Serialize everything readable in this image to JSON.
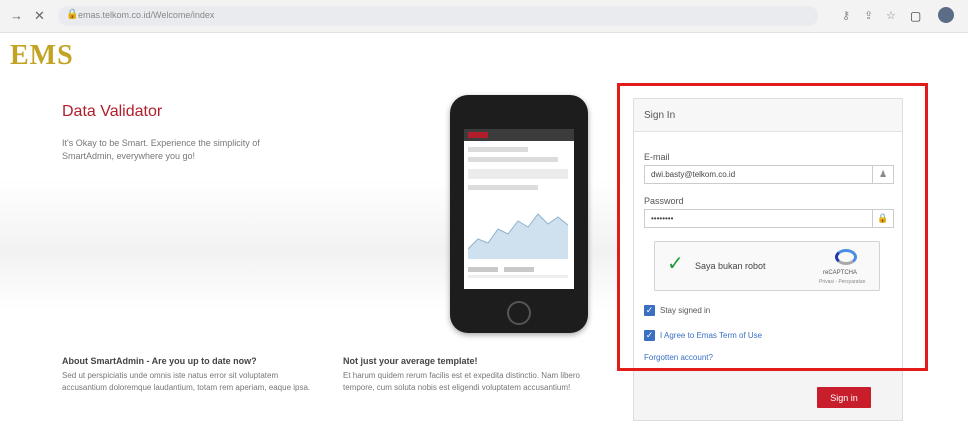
{
  "browser": {
    "url": "emas.telkom.co.id/Welcome/index"
  },
  "brand": {
    "logo_text": "EMS",
    "accent_color": "#c2a323",
    "highlight_color": "#e21b1b"
  },
  "hero": {
    "title": "Data Validator",
    "description": "It's Okay to be Smart. Experience the simplicity of SmartAdmin, everywhere you go!"
  },
  "sections": {
    "about": {
      "title": "About SmartAdmin - Are you up to date now?",
      "text": "Sed ut perspiciatis unde omnis iste natus error sit voluptatem accusantium doloremque laudantium, totam rem aperiam, eaque ipsa."
    },
    "template": {
      "title": "Not just your average template!",
      "text": "Et harum quidem rerum facilis est et expedita distinctio. Nam libero tempore, cum soluta nobis est eligendi voluptatem accusantium!"
    }
  },
  "signin": {
    "header": "Sign In",
    "email_label": "E-mail",
    "email_value": "dwi.basty@telkom.co.id",
    "password_label": "Password",
    "password_value": "••••••••",
    "captcha_label": "Saya bukan robot",
    "captcha_brand": "reCAPTCHA",
    "captcha_links": "Privasi - Persyaratan",
    "stay_signed_in": "Stay signed in",
    "agree_terms": "I Agree to Emas Term of Use",
    "forgot": "Forgotten account?",
    "button": "Sign in"
  }
}
